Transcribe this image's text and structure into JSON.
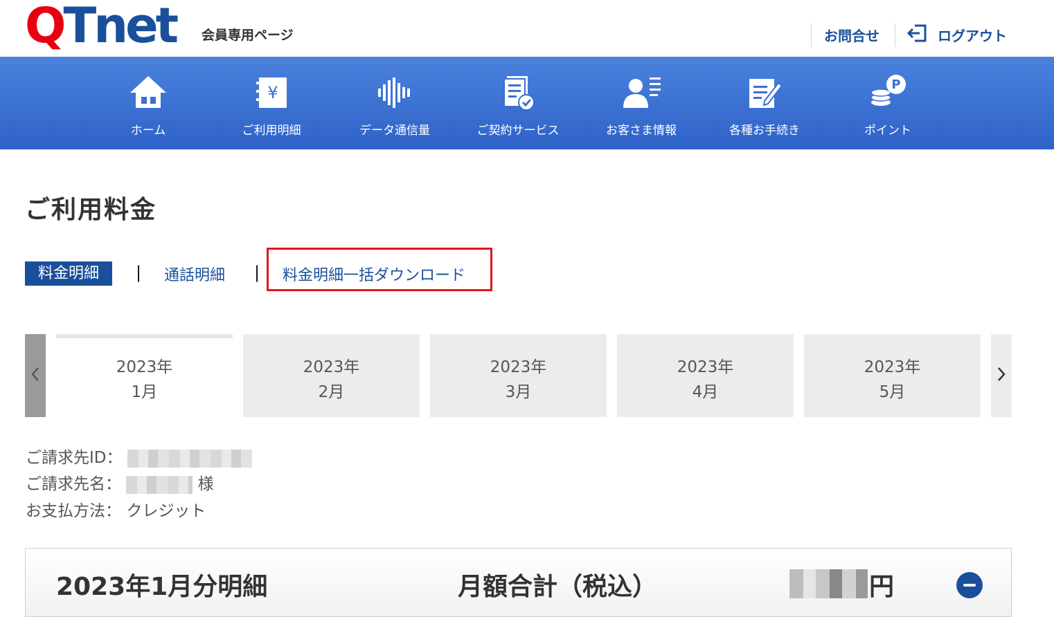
{
  "header": {
    "logo_q": "Q",
    "logo_net": "Tnet",
    "subtitle": "会員専用ページ",
    "contact_label": "お問合せ",
    "logout_label": "ログアウト"
  },
  "nav": {
    "items": [
      {
        "label": "ホーム",
        "icon": "home-icon"
      },
      {
        "label": "ご利用明細",
        "icon": "bill-icon"
      },
      {
        "label": "データ通信量",
        "icon": "waveform-icon"
      },
      {
        "label": "ご契約サービス",
        "icon": "contract-icon"
      },
      {
        "label": "お客さま情報",
        "icon": "user-info-icon"
      },
      {
        "label": "各種お手続き",
        "icon": "edit-form-icon"
      },
      {
        "label": "ポイント",
        "icon": "points-coin-icon"
      }
    ]
  },
  "page": {
    "title": "ご利用料金"
  },
  "tabs": {
    "active": "料金明細",
    "separator": "|",
    "call_details": "通話明細",
    "bulk_download": "料金明細一括ダウンロード"
  },
  "months": [
    {
      "year": "2023年",
      "month": "1月",
      "active": true
    },
    {
      "year": "2023年",
      "month": "2月",
      "active": false
    },
    {
      "year": "2023年",
      "month": "3月",
      "active": false
    },
    {
      "year": "2023年",
      "month": "4月",
      "active": false
    },
    {
      "year": "2023年",
      "month": "5月",
      "active": false
    }
  ],
  "billing": {
    "id_label": "ご請求先ID：",
    "name_label": "ご請求先名：",
    "name_suffix": "様",
    "payment_label": "お支払方法：",
    "payment_value": "クレジット"
  },
  "summary": {
    "title": "2023年1月分明細",
    "monthly_total_label": "月額合計（税込）",
    "currency": "円"
  },
  "colors": {
    "brand_red": "#e60012",
    "brand_blue": "#1a4f9c",
    "nav_blue": "#3a6fd4",
    "highlight_red": "#e0151f"
  }
}
